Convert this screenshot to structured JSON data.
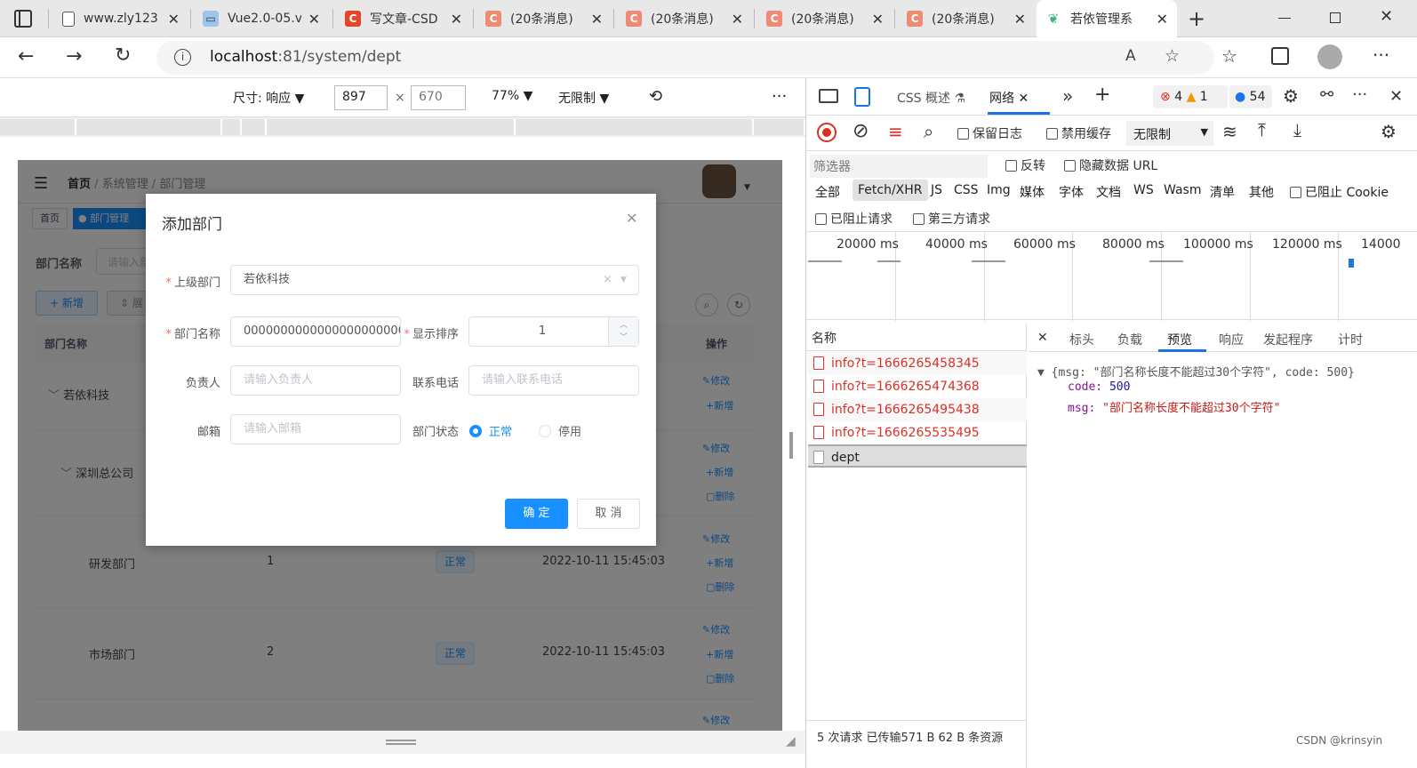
{
  "browser": {
    "tabs": [
      {
        "title": "www.zly123",
        "favicon": "page-icon"
      },
      {
        "title": "Vue2.0-05.v",
        "favicon": "vue-icon"
      },
      {
        "title": "写文章-CSD",
        "favicon": "csdn-icon"
      },
      {
        "title": "(20条消息)",
        "favicon": "csdn-icon"
      },
      {
        "title": "(20条消息)",
        "favicon": "csdn-icon"
      },
      {
        "title": "(20条消息)",
        "favicon": "csdn-icon"
      },
      {
        "title": "(20条消息)",
        "favicon": "csdn-icon"
      },
      {
        "title": "若依管理系",
        "favicon": "ruoyi-icon"
      }
    ],
    "url_host": "localhost",
    "url_rest": ":81/system/dept"
  },
  "device_toolbar": {
    "size_label": "尺寸: 响应",
    "width": "897",
    "height": "670",
    "zoom": "77%",
    "throttle": "无限制"
  },
  "app": {
    "breadcrumb": [
      "首页",
      "系统管理",
      "部门管理"
    ],
    "tags": [
      "首页",
      "● 部门管理"
    ],
    "search_label": "部门名称",
    "search_placeholder": "请输入部",
    "add_button": "+ 新增",
    "expand_button": "⇕ 展",
    "table_headers": {
      "name": "部门名称",
      "op": "操作"
    },
    "rows": [
      {
        "name": "若依科技",
        "order": "",
        "status": "",
        "time": ""
      },
      {
        "name": "深圳总公司",
        "order": "",
        "status": "",
        "time": ""
      },
      {
        "name": "研发部门",
        "order": "1",
        "status": "正常",
        "time": "2022-10-11 15:45:03"
      },
      {
        "name": "市场部门",
        "order": "2",
        "status": "正常",
        "time": "2022-10-11 15:45:03"
      }
    ],
    "op_links": {
      "edit": "修改",
      "add": "新增",
      "del": "删除"
    }
  },
  "dialog": {
    "title": "添加部门",
    "parent_label": "上级部门",
    "parent_value": "若依科技",
    "name_label": "部门名称",
    "name_value": "00000000000000000000000",
    "order_label": "显示排序",
    "order_value": "1",
    "leader_label": "负责人",
    "leader_placeholder": "请输入负责人",
    "phone_label": "联系电话",
    "phone_placeholder": "请输入联系电话",
    "email_label": "邮箱",
    "email_placeholder": "请输入邮箱",
    "status_label": "部门状态",
    "status_normal": "正常",
    "status_disabled": "停用",
    "confirm": "确 定",
    "cancel": "取 消"
  },
  "devtools": {
    "tabs": [
      "CSS 概述",
      "网络"
    ],
    "errors": "4",
    "warnings": "1",
    "messages": "54",
    "preserve_log": "保留日志",
    "disable_cache": "禁用缓存",
    "throttle": "无限制",
    "filter_placeholder": "筛选器",
    "invert": "反转",
    "hide_data_url": "隐藏数据 URL",
    "type_filters": [
      "全部",
      "Fetch/XHR",
      "JS",
      "CSS",
      "Img",
      "媒体",
      "字体",
      "文档",
      "WS",
      "Wasm",
      "清单",
      "其他"
    ],
    "blocked_cookies": "已阻止 Cookie",
    "blocked_requests": "已阻止请求",
    "third_party": "第三方请求",
    "timeline": [
      "20000 ms",
      "40000 ms",
      "60000 ms",
      "80000 ms",
      "100000 ms",
      "120000 ms",
      "14000"
    ],
    "name_header": "名称",
    "requests": [
      "info?t=1666265458345",
      "info?t=1666265474368",
      "info?t=1666265495438",
      "info?t=1666265535495",
      "dept"
    ],
    "detail_tabs": [
      "标头",
      "负载",
      "预览",
      "响应",
      "发起程序",
      "计时"
    ],
    "preview_summary": "{msg: \"部门名称长度不能超过30个字符\", code: 500}",
    "preview_code_key": "code:",
    "preview_code_val": "500",
    "preview_msg_key": "msg:",
    "preview_msg_val": "\"部门名称长度不能超过30个字符\"",
    "status_bar": "5 次请求  已传输571 B  62 B 条资源"
  },
  "watermark": "CSDN @krinsyin"
}
